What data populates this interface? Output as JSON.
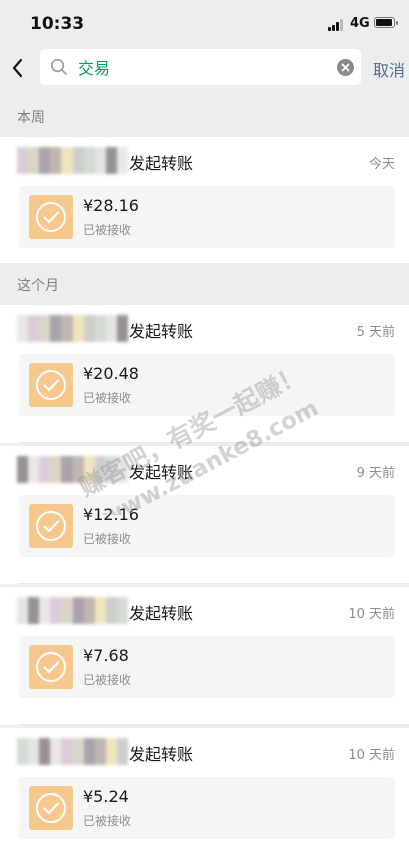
{
  "status_bar": {
    "time": "10:33",
    "network": "4G"
  },
  "search": {
    "query": "交易",
    "cancel_label": "取消"
  },
  "sections": [
    {
      "title": "本周"
    },
    {
      "title": "这个月"
    }
  ],
  "records": [
    {
      "title": "发起转账",
      "time": "今天",
      "amount": "¥28.16",
      "status": "已被接收"
    },
    {
      "title": "发起转账",
      "time": "5 天前",
      "amount": "¥20.48",
      "status": "已被接收"
    },
    {
      "title": "发起转账",
      "time": "9 天前",
      "amount": "¥12.16",
      "status": "已被接收"
    },
    {
      "title": "发起转账",
      "time": "10 天前",
      "amount": "¥7.68",
      "status": "已被接收"
    },
    {
      "title": "发起转账",
      "time": "10 天前",
      "amount": "¥5.24",
      "status": "已被接收"
    }
  ],
  "watermark": {
    "line1": "赚客吧，有奖一起赚！",
    "line2": "www.zuanke8.com"
  },
  "colors": {
    "background": "#ededed",
    "search_text": "#07a05a",
    "cancel_link": "#576b95",
    "transfer_icon": "#f7c88e",
    "watermark": "#9b9b9b"
  },
  "icons": {
    "back": "chevron-left-icon",
    "search": "magnifier-icon",
    "clear": "clear-circle-icon",
    "transfer": "check-circle-icon",
    "signal": "signal-bars-icon",
    "battery": "battery-icon"
  }
}
